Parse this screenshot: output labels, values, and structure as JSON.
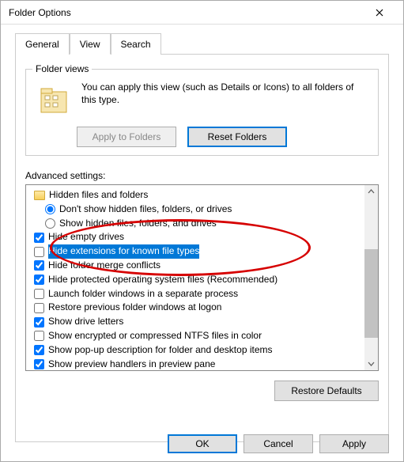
{
  "window": {
    "title": "Folder Options"
  },
  "tabs": {
    "general": "General",
    "view": "View",
    "search": "Search",
    "active": "view"
  },
  "folder_views": {
    "legend": "Folder views",
    "text": "You can apply this view (such as Details or Icons) to all folders of this type.",
    "apply_btn": "Apply to Folders",
    "reset_btn": "Reset Folders"
  },
  "advanced": {
    "label": "Advanced settings:",
    "items": [
      {
        "type": "folder",
        "label": "Hidden files and folders"
      },
      {
        "type": "radio",
        "label": "Don't show hidden files, folders, or drives",
        "checked": true,
        "selected": false
      },
      {
        "type": "radio",
        "label": "Show hidden files, folders, and drives",
        "checked": false,
        "selected": false
      },
      {
        "type": "check",
        "label": "Hide empty drives",
        "checked": true,
        "selected": false
      },
      {
        "type": "check",
        "label": "Hide extensions for known file types",
        "checked": false,
        "selected": true
      },
      {
        "type": "check",
        "label": "Hide folder merge conflicts",
        "checked": true,
        "selected": false
      },
      {
        "type": "check",
        "label": "Hide protected operating system files (Recommended)",
        "checked": true,
        "selected": false
      },
      {
        "type": "check",
        "label": "Launch folder windows in a separate process",
        "checked": false,
        "selected": false
      },
      {
        "type": "check",
        "label": "Restore previous folder windows at logon",
        "checked": false,
        "selected": false
      },
      {
        "type": "check",
        "label": "Show drive letters",
        "checked": true,
        "selected": false
      },
      {
        "type": "check",
        "label": "Show encrypted or compressed NTFS files in color",
        "checked": false,
        "selected": false
      },
      {
        "type": "check",
        "label": "Show pop-up description for folder and desktop items",
        "checked": true,
        "selected": false
      },
      {
        "type": "check",
        "label": "Show preview handlers in preview pane",
        "checked": true,
        "selected": false
      }
    ]
  },
  "restore_defaults": "Restore Defaults",
  "buttons": {
    "ok": "OK",
    "cancel": "Cancel",
    "apply": "Apply"
  }
}
